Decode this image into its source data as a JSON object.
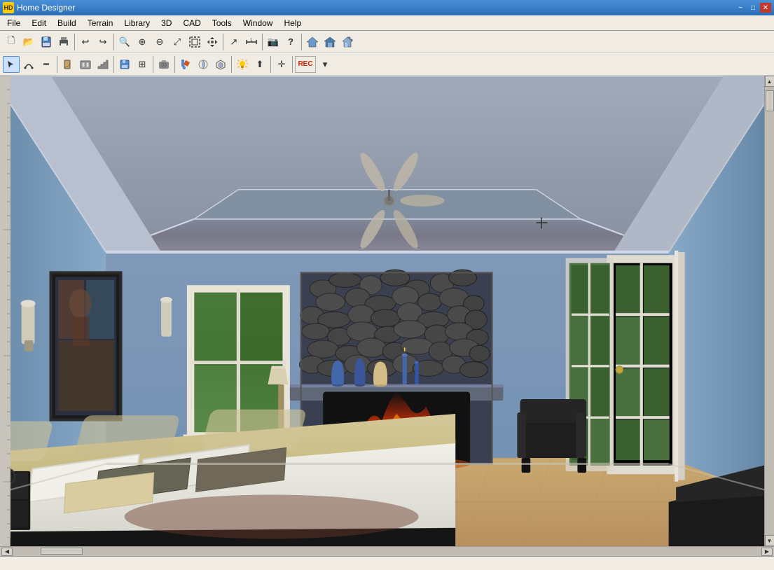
{
  "titlebar": {
    "title": "Home Designer",
    "icon": "HD",
    "minimize": "−",
    "maximize": "□",
    "close": "✕"
  },
  "menubar": {
    "items": [
      "File",
      "Edit",
      "Build",
      "Terrain",
      "Library",
      "3D",
      "CAD",
      "Tools",
      "Window",
      "Help"
    ]
  },
  "toolbar1": {
    "buttons": [
      {
        "name": "new",
        "icon": "🗋"
      },
      {
        "name": "open",
        "icon": "📂"
      },
      {
        "name": "save",
        "icon": "💾"
      },
      {
        "name": "print",
        "icon": "🖨"
      },
      {
        "name": "undo",
        "icon": "↩"
      },
      {
        "name": "redo",
        "icon": "↪"
      },
      {
        "name": "zoom-in-glass",
        "icon": "🔍"
      },
      {
        "name": "zoom-in",
        "icon": "⊕"
      },
      {
        "name": "zoom-out",
        "icon": "⊖"
      },
      {
        "name": "zoom-fit",
        "icon": "⤢"
      },
      {
        "name": "zoom-select",
        "icon": "▣"
      },
      {
        "name": "pan",
        "icon": "✋"
      },
      {
        "name": "arrow",
        "icon": "↗"
      },
      {
        "name": "camera",
        "icon": "📷"
      },
      {
        "name": "question",
        "icon": "?"
      },
      {
        "name": "house1",
        "icon": "🏠"
      },
      {
        "name": "house2",
        "icon": "🏡"
      },
      {
        "name": "house3",
        "icon": "⌂"
      }
    ]
  },
  "toolbar2": {
    "buttons": [
      {
        "name": "select",
        "icon": "↖"
      },
      {
        "name": "arc",
        "icon": "⌒"
      },
      {
        "name": "wall",
        "icon": "━"
      },
      {
        "name": "door",
        "icon": "🚪"
      },
      {
        "name": "stairs",
        "icon": "▦"
      },
      {
        "name": "save2",
        "icon": "💾"
      },
      {
        "name": "dimension",
        "icon": "⊞"
      },
      {
        "name": "plan",
        "icon": "📋"
      },
      {
        "name": "camera2",
        "icon": "📷"
      },
      {
        "name": "paint",
        "icon": "🖌"
      },
      {
        "name": "material",
        "icon": "🎨"
      },
      {
        "name": "texture",
        "icon": "⬡"
      },
      {
        "name": "light",
        "icon": "💡"
      },
      {
        "name": "arrow-up",
        "icon": "⬆"
      },
      {
        "name": "move",
        "icon": "✛"
      },
      {
        "name": "rec",
        "icon": "REC"
      }
    ]
  },
  "statusbar": {
    "text": ""
  },
  "scene": {
    "description": "3D bedroom render with fireplace, bed, and windows"
  }
}
